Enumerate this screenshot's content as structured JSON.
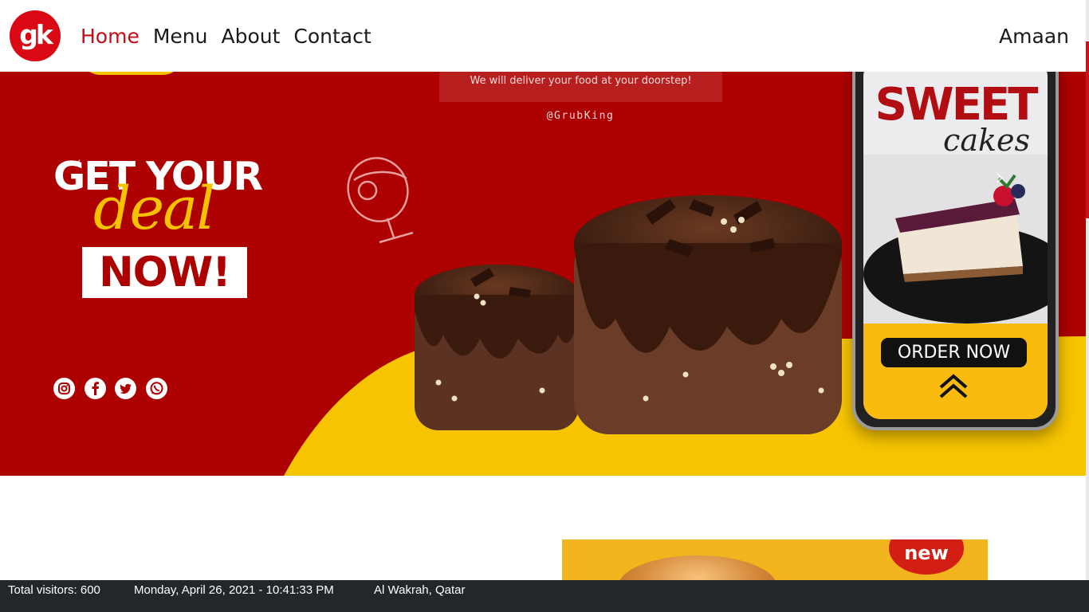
{
  "brand": {
    "logo_text": "gk",
    "accent": "#c80b14"
  },
  "nav": {
    "items": [
      {
        "label": "Home",
        "active": true
      },
      {
        "label": "Menu",
        "active": false
      },
      {
        "label": "About",
        "active": false
      },
      {
        "label": "Contact",
        "active": false
      }
    ],
    "user": "Amaan"
  },
  "hero": {
    "delivery_text": "We will deliver your food at your doorstep!",
    "handle": "@GrubKing",
    "headline_top": "GET YOUR",
    "headline_script": "deal",
    "headline_box": "NOW!",
    "social_icons": [
      "instagram-icon",
      "facebook-icon",
      "twitter-icon",
      "whatsapp-icon"
    ],
    "phone": {
      "title": "SWEET",
      "subtitle": "cakes",
      "cta": "ORDER NOW"
    },
    "colors": {
      "red": "#ad0000",
      "yellow": "#f6c400"
    }
  },
  "promo": {
    "badge": "new"
  },
  "status": {
    "visitors": "Total visitors: 600",
    "datetime": "Monday, April 26, 2021 - 10:41:33 PM",
    "location": "Al Wakrah, Qatar"
  }
}
